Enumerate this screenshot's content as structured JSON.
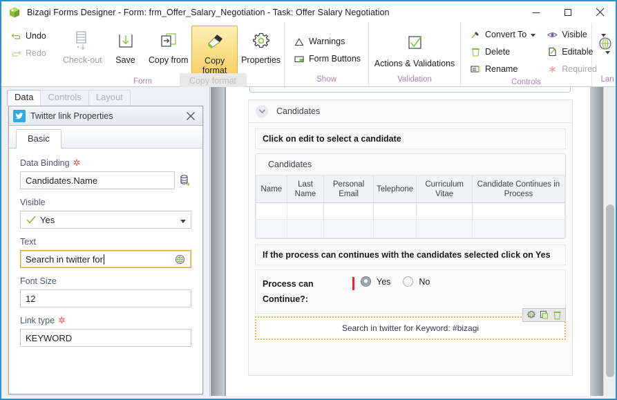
{
  "window": {
    "logo_icon": "bizagi-cube-icon",
    "title": "Bizagi Forms Designer  - Form: frm_Offer_Salary_Negotiation - Task:  Offer Salary Negotiation",
    "controls": [
      {
        "name": "minimize-button",
        "icon": "minimize-icon"
      },
      {
        "name": "maximize-button",
        "icon": "maximize-icon"
      },
      {
        "name": "close-button",
        "icon": "close-icon"
      }
    ]
  },
  "ribbon": {
    "groups": [
      {
        "name": "form",
        "label": "Form",
        "small_commands": [
          {
            "label": "Undo",
            "icon": "undo-icon",
            "disabled": false
          },
          {
            "label": "Redo",
            "icon": "redo-icon",
            "disabled": true
          }
        ],
        "big_commands": [
          {
            "label": "Check-out",
            "icon": "check-out-icon",
            "disabled": true,
            "active": false
          },
          {
            "label": "Save",
            "icon": "save-icon",
            "disabled": false,
            "active": false
          },
          {
            "label": "Copy from",
            "icon": "copy-from-icon",
            "disabled": false,
            "active": false
          },
          {
            "label": "Copy format",
            "icon": "copy-format-brush-icon",
            "disabled": false,
            "active": true
          },
          {
            "label": "Properties",
            "icon": "gear-icon",
            "disabled": false,
            "active": false
          }
        ],
        "tooltip": "Copy format"
      },
      {
        "name": "show",
        "label": "Show",
        "small_commands": [
          {
            "label": "Warnings",
            "icon": "warning-triangle-icon",
            "disabled": false
          },
          {
            "label": "Form Buttons",
            "icon": "form-buttons-icon",
            "disabled": false
          }
        ],
        "big_commands": []
      },
      {
        "name": "validation",
        "label": "Validation",
        "small_commands": [],
        "big_commands": [
          {
            "label": "Actions & Validations",
            "icon": "checkbox-check-icon",
            "disabled": false,
            "active": false
          }
        ]
      },
      {
        "name": "controls",
        "label": "Controls",
        "small_commands": [
          {
            "label": "Convert To",
            "icon": "convert-to-icon",
            "disabled": false,
            "dropdown": true
          },
          {
            "label": "Delete",
            "icon": "trash-icon",
            "disabled": false
          },
          {
            "label": "Rename",
            "icon": "rename-icon",
            "disabled": false
          },
          {
            "label": "Visible",
            "icon": "eye-icon",
            "disabled": false,
            "dropdown": true
          },
          {
            "label": "Editable",
            "icon": "editable-page-icon",
            "disabled": false,
            "dropdown": true
          },
          {
            "label": "Required",
            "icon": "required-asterisk-icon",
            "disabled": true
          }
        ],
        "big_commands": []
      },
      {
        "name": "language",
        "label": "Lan",
        "small_commands": [],
        "big_commands": [
          {
            "label": "",
            "icon": "globe-icon",
            "disabled": false,
            "active": false
          }
        ]
      }
    ]
  },
  "left_panel": {
    "tabs": [
      {
        "label": "Data",
        "selected": true
      },
      {
        "label": "Controls",
        "selected": false
      },
      {
        "label": "Layout",
        "selected": false
      }
    ],
    "properties_window": {
      "icon": "twitter-bird-icon",
      "title": "Twitter link Properties",
      "close_icon": "close-icon",
      "inner_tab": "Basic",
      "fields": [
        {
          "label": "Data Binding",
          "required": true,
          "type": "text-with-button",
          "value": "Candidates.Name",
          "placeholder": "",
          "button_icon": "database-add-icon"
        },
        {
          "label": "Visible",
          "required": false,
          "type": "select",
          "value": "Yes",
          "value_icon": "green-check-icon",
          "dropdown_icon": "chevron-down-icon"
        },
        {
          "label": "Text",
          "required": false,
          "type": "text-with-inline-icon",
          "value": "Search in twitter for",
          "placeholder": "",
          "focused": true,
          "inline_icon": "globe-language-icon"
        },
        {
          "label": "Font Size",
          "required": false,
          "type": "text",
          "value": "12",
          "placeholder": ""
        },
        {
          "label": "Link type",
          "required": true,
          "type": "text",
          "value": "KEYWORD",
          "placeholder": ""
        }
      ]
    }
  },
  "canvas": {
    "group": {
      "collapse_icon": "chevron-down-icon",
      "title": "Candidates"
    },
    "note_top": "Click on edit to select a candidate",
    "table": {
      "caption": "Candidates",
      "columns": [
        "Name",
        "Last Name",
        "Personal Email",
        "Telephone",
        "Curriculum Vitae",
        "Candidate Continues in Process"
      ],
      "rows": [
        [],
        []
      ]
    },
    "note_bottom": "If the process can continues with the candidates selected click on Yes",
    "radio_field": {
      "label": "Process can Continue?:",
      "required": true,
      "options": [
        {
          "label": "Yes",
          "selected": true
        },
        {
          "label": "No",
          "selected": false
        }
      ]
    },
    "selected_widget": {
      "text": "Search in twitter for Keyword: #bizagi",
      "actions": [
        {
          "name": "widget-properties-button",
          "icon": "gear-icon"
        },
        {
          "name": "widget-duplicate-button",
          "icon": "duplicate-icon"
        },
        {
          "name": "widget-delete-button",
          "icon": "trash-icon"
        }
      ]
    },
    "scrollbar": {
      "name": "canvas-vertical-scrollbar"
    }
  },
  "colors": {
    "window_border": "#2f8fd4",
    "ribbon_group_label": "#b07fae",
    "accent_green": "#8cbe3f",
    "active_button": "#f8d066",
    "required_red": "#e8252a",
    "selection_dotted": "#eab544",
    "twitter_blue": "#2daae1"
  }
}
